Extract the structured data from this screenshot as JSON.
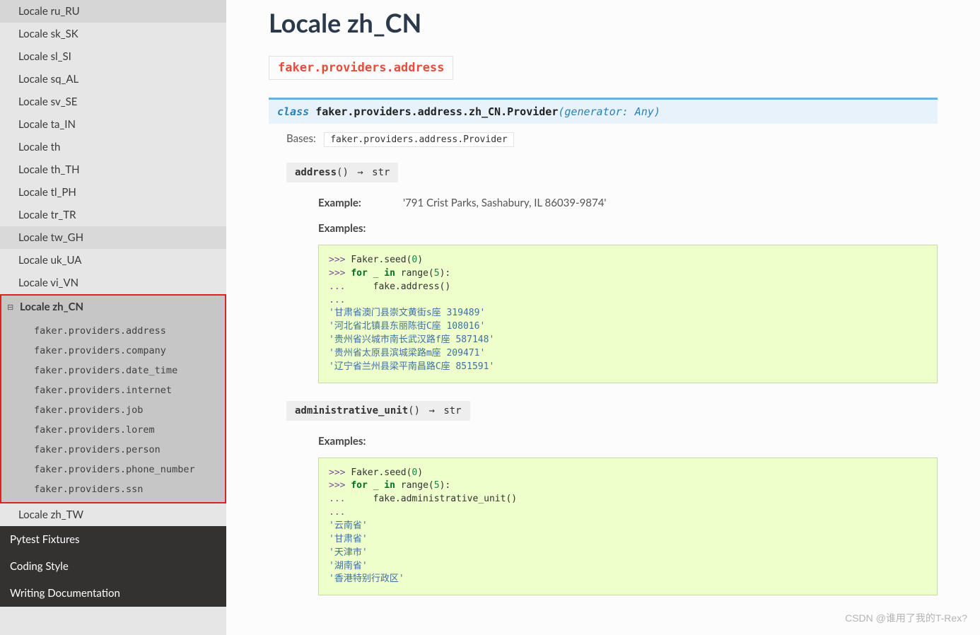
{
  "sidebar": {
    "locales_before": [
      "Locale ru_RU",
      "Locale sk_SK",
      "Locale sl_SI",
      "Locale sq_AL",
      "Locale sv_SE",
      "Locale ta_IN",
      "Locale th",
      "Locale th_TH",
      "Locale tl_PH",
      "Locale tr_TR",
      "Locale tw_GH",
      "Locale uk_UA",
      "Locale vi_VN"
    ],
    "highlight_index": 10,
    "active": "Locale zh_CN",
    "sub_items": [
      "faker.providers.address",
      "faker.providers.company",
      "faker.providers.date_time",
      "faker.providers.internet",
      "faker.providers.job",
      "faker.providers.lorem",
      "faker.providers.person",
      "faker.providers.phone_number",
      "faker.providers.ssn"
    ],
    "locales_after": [
      "Locale zh_TW"
    ],
    "footer": [
      "Pytest Fixtures",
      "Coding Style",
      "Writing Documentation"
    ]
  },
  "main": {
    "title": "Locale zh_CN",
    "module_box": "faker.providers.address",
    "class_sig": {
      "keyword": "class",
      "path": "faker.providers.address.zh_CN.",
      "name": "Provider",
      "params": "generator: Any"
    },
    "bases_label": "Bases:",
    "bases_value": "faker.providers.address.Provider",
    "methods": [
      {
        "name": "address",
        "params": "()",
        "return": "str",
        "example_row": {
          "k": "Example:",
          "v": "'791 Crist Parks, Sashabury, IL 86039-9874'"
        },
        "examples_label": "Examples:",
        "code": {
          "seed_call": "Faker.seed(",
          "seed_arg": "0",
          "for_kw": "for",
          "for_rest": " _ ",
          "in_kw": "in",
          "range_call": " range(",
          "range_arg": "5",
          "body": "    fake.address()",
          "outputs": [
            "'甘肃省澳门县崇文黄街s座 319489'",
            "'河北省北镇县东丽陈街C座 108016'",
            "'贵州省兴城市南长武汉路f座 587148'",
            "'贵州省太原县滨城梁路m座 209471'",
            "'辽宁省兰州县梁平南昌路C座 851591'"
          ]
        }
      },
      {
        "name": "administrative_unit",
        "params": "()",
        "return": "str",
        "examples_label": "Examples:",
        "code": {
          "seed_call": "Faker.seed(",
          "seed_arg": "0",
          "for_kw": "for",
          "for_rest": " _ ",
          "in_kw": "in",
          "range_call": " range(",
          "range_arg": "5",
          "body": "    fake.administrative_unit()",
          "outputs": [
            "'云南省'",
            "'甘肃省'",
            "'天津市'",
            "'湖南省'",
            "'香港特别行政区'"
          ]
        }
      }
    ]
  },
  "watermark": "CSDN @谁用了我的T-Rex?"
}
